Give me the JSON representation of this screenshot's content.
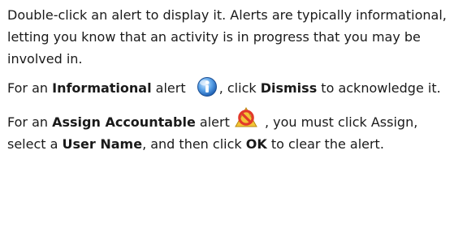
{
  "help": {
    "para1": "Double-click an alert to display it. Alerts are typically informational, letting you know that an activity is in progress that you may be involved in.",
    "para2": {
      "prefix": "For an ",
      "alert_type": "Informational",
      "alert_word": " alert ",
      "after_icon": ", click ",
      "action": "Dismiss",
      "suffix": " to acknowledge it.",
      "icon": "info-icon"
    },
    "para3": {
      "prefix": "For an ",
      "alert_type": "Assign Accountable",
      "alert_word": " alert ",
      "after_icon": ", you must click Assign, select a ",
      "field": "User Name",
      "mid": ", and then click ",
      "button": "OK",
      "suffix": " to clear the alert.",
      "icon": "assign-accountable-alert-icon"
    }
  },
  "colors": {
    "text": "#1a1a1a",
    "info_blue": "#2f7fd0",
    "warning_red": "#e23a2a",
    "warning_yellow": "#f3c437"
  }
}
